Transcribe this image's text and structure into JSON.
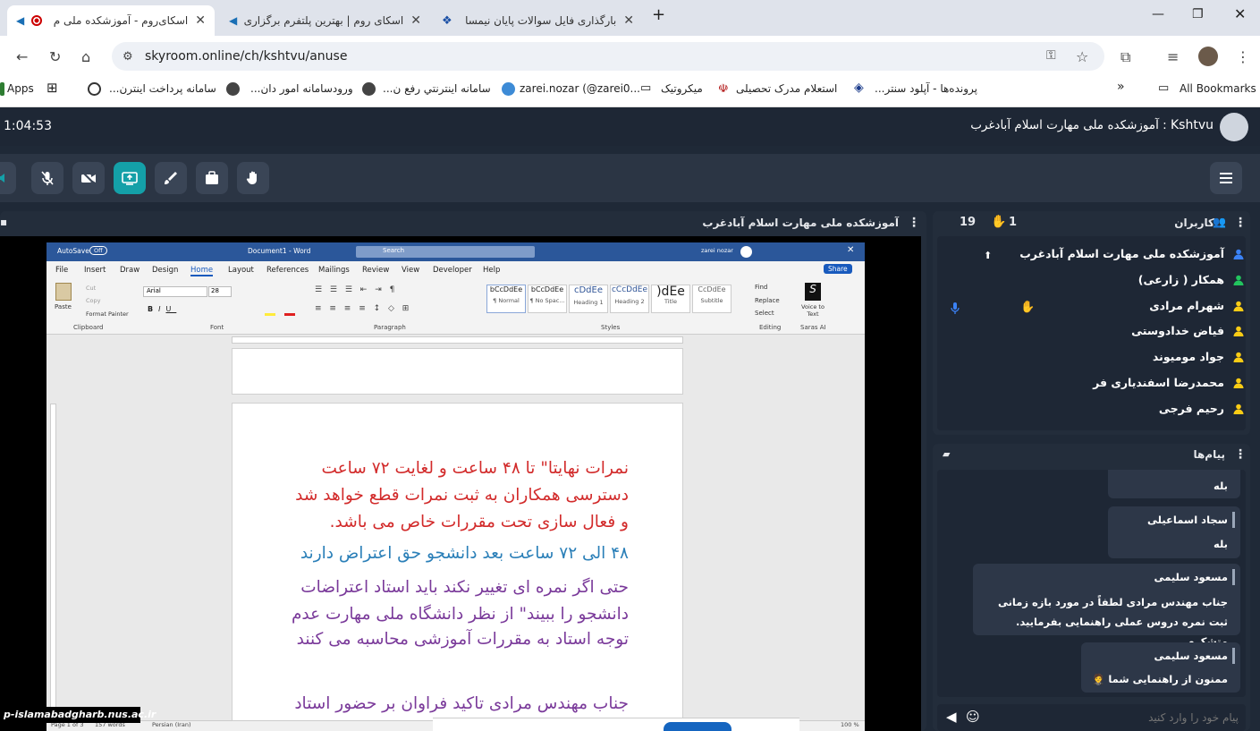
{
  "browser": {
    "tabs": [
      {
        "title": "اسکای‌روم - آموزشکده ملی م",
        "active": true
      },
      {
        "title": "اسکای روم | بهترین پلتفرم برگزاری",
        "active": false
      },
      {
        "title": "بارگذاری فایل سوالات پایان نیمسا",
        "active": false
      }
    ],
    "url": "skyroom.online/ch/kshtvu/anuse",
    "bookmarks": [
      "Apps",
      "سامانه پرداخت اینترن...",
      "ورودسامانه امور دان...",
      "سامانه اينترنتي رفع ن...",
      "zarei.nozar (@zarei0...",
      "میکروتیک",
      "استعلام مدرک تحصیلی",
      "پرونده‌ها - آپلود سنتر...",
      "All Bookmarks"
    ]
  },
  "app": {
    "timer": "1:04:53",
    "room_user": "Kshtvu",
    "room_title": ": آموزشکده ملی مهارت اسلام آبادغرب",
    "share_panel_title": "آموزشکده ملی مهارت اسلام آبادغرب",
    "users_panel_title": "کاربران",
    "users_count": "19",
    "hands_count": "1",
    "users": [
      {
        "name": "آموزشکده ملی مهارت اسلام آبادغرب",
        "color": "#3b82f6"
      },
      {
        "name": "همکار ( زارعی)",
        "color": "#22c55e"
      },
      {
        "name": "شهرام مرادی",
        "color": "#facc15"
      },
      {
        "name": "فیاض خدادوستی",
        "color": "#facc15"
      },
      {
        "name": "جواد مومیوند",
        "color": "#facc15"
      },
      {
        "name": "محمدرضا اسفندیاری فر",
        "color": "#facc15"
      },
      {
        "name": "رحیم فرجی",
        "color": "#facc15"
      }
    ],
    "messages_panel_title": "پیام‌ها",
    "messages": [
      {
        "name": "",
        "text": "بله"
      },
      {
        "name": "سجاد اسماعیلی",
        "text": "بله"
      },
      {
        "name": "مسعود سلیمی",
        "text": "جناب مهندس مرادی لطفاً در مورد بازه زمانی ثبت نمره دروس عملی راهنمایی بفرمایید. متشکرم"
      },
      {
        "name": "مسعود سلیمی",
        "text": "ممنون از راهنمایی شما 🤵"
      }
    ],
    "compose_placeholder": "پیام خود را وارد کنید",
    "watermark": "p-islamabadgharb.nus.ac.ir"
  },
  "word": {
    "autosave": "AutoSave",
    "autosave_state": "Off",
    "doc_title": "Document1 - Word",
    "search": "Search",
    "user": "zarei nozar",
    "share": "Share",
    "tabs": [
      "File",
      "Insert",
      "Draw",
      "Design",
      "Home",
      "Layout",
      "References",
      "Mailings",
      "Review",
      "View",
      "Developer",
      "Help"
    ],
    "font": "Arial",
    "font_size": "28",
    "styles": [
      {
        "sample": "bCcDdEe",
        "name": "¶ Normal"
      },
      {
        "sample": "bCcDdEe",
        "name": "¶ No Spac..."
      },
      {
        "sample": "cDdEe",
        "name": "Heading 1"
      },
      {
        "sample": "cCcDdEe",
        "name": "Heading 2"
      },
      {
        "sample": ")dEe",
        "name": "Title"
      },
      {
        "sample": "CcDdEe",
        "name": "Subtitle"
      }
    ],
    "groups": [
      "Clipboard",
      "Font",
      "Paragraph",
      "Styles",
      "Editing",
      "Saras AI"
    ],
    "clipboard": {
      "paste": "Paste",
      "cut": "Cut",
      "copy": "Copy",
      "painter": "Format Painter"
    },
    "editing": {
      "find": "Find",
      "replace": "Replace",
      "select": "Select"
    },
    "voice": "Voice to Text",
    "status": {
      "page": "Page 1 of 3",
      "words": "157 words",
      "lang": "Persian (Iran)",
      "zoom": "100 %"
    },
    "paragraphs": [
      {
        "text": "نمرات نهایتا\" تا ۴۸ ساعت و لغایت ۷۲ ساعت",
        "color": "#d22a2a"
      },
      {
        "text": "دسترسی همکاران به ثبت نمرات قطع خواهد شد",
        "color": "#d22a2a"
      },
      {
        "text": "و فعال سازی تحت مقررات خاص می باشد.",
        "color": "#d22a2a"
      },
      {
        "text": "۴۸ الی ۷۲ ساعت بعد دانشجو حق اعتراض دارند",
        "color": "#2a7fb8"
      },
      {
        "text": "حتی اگر نمره ای تغییر نکند باید استاد اعتراضات",
        "color": "#7a3a9a"
      },
      {
        "text": "دانشجو را ببیند\" از نظر دانشگاه ملی مهارت عدم",
        "color": "#7a3a9a"
      },
      {
        "text": "توجه استاد به مقررات آموزشی محاسبه می کنند",
        "color": "#7a3a9a"
      },
      {
        "text": "جناب مهندس مرادی تاکید فراوان بر حضور استاد",
        "color": "#7a3a9a"
      }
    ]
  }
}
